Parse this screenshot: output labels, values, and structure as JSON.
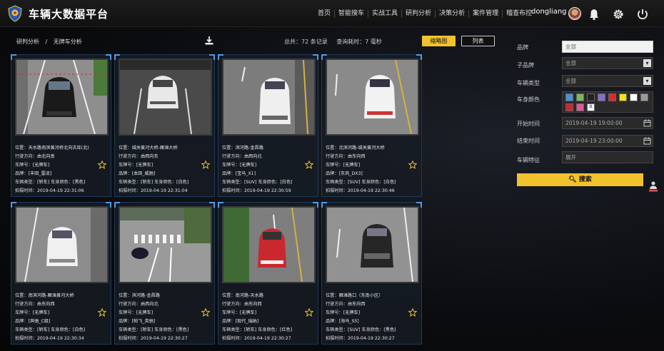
{
  "header": {
    "title": "车辆大数据平台",
    "nav": [
      "首页",
      "智能搜车",
      "实战工具",
      "研判分析",
      "决策分析",
      "案件管理",
      "稽查布控"
    ],
    "username": "dongliang",
    "icons": [
      "shield-logo-icon",
      "bell-icon",
      "gear-icon",
      "power-icon"
    ]
  },
  "breadcrumb": [
    "研判分析",
    "/",
    "无牌车分析"
  ],
  "summary": {
    "total": "总共：72 条记录",
    "time": "查询耗时：7 毫秒"
  },
  "view_buttons": {
    "thumb": "缩略图",
    "list": "列表"
  },
  "cards": [
    {
      "loc": "位置：",
      "loc_v": "天水路南滨黄河桥北向古库(北)",
      "dir": "行驶方向：",
      "dir_v": "由北向南",
      "plate": "车牌号：",
      "plate_v": "[无牌车]",
      "brand": "品牌：",
      "brand_v": "[丰田_雷凌]",
      "type": "车辆类型：",
      "type_v": "[轿车]",
      "color": "车身颜色：",
      "color_v": "[黑色]",
      "time": "拍摄时间：",
      "time_v": "2019-04-19 22:31:06"
    },
    {
      "loc": "位置：",
      "loc_v": "城关黄河大桥-雁滩大桥",
      "dir": "行驶方向：",
      "dir_v": "由西向东",
      "plate": "车牌号：",
      "plate_v": "[无牌车]",
      "brand": "品牌：",
      "brand_v": "[本田_威驰]",
      "type": "车辆类型：",
      "type_v": "[轿车]",
      "color": "车身颜色：",
      "color_v": "[白色]",
      "time": "拍摄时间：",
      "time_v": "2019-04-19 22:31:04"
    },
    {
      "loc": "位置：",
      "loc_v": "滨河路-金昌路",
      "dir": "行驶方向：",
      "dir_v": "由西向北",
      "plate": "车牌号：",
      "plate_v": "[无牌车]",
      "brand": "品牌：",
      "brand_v": "[宝马_X1]",
      "type": "车辆类型：",
      "type_v": "[SUV]",
      "color": "车身颜色：",
      "color_v": "[白色]",
      "time": "拍摄时间：",
      "time_v": "2019-04-19 22:30:59"
    },
    {
      "loc": "位置：",
      "loc_v": "北滨河路-城关黄河大桥",
      "dir": "行驶方向：",
      "dir_v": "由东向西",
      "plate": "车牌号：",
      "plate_v": "[无牌车]",
      "brand": "品牌：",
      "brand_v": "[东风_DX3]",
      "type": "车辆类型：",
      "type_v": "[SUV]",
      "color": "车身颜色：",
      "color_v": "[白色]",
      "time": "拍摄时间：",
      "time_v": "2019-04-19 22:30:46"
    },
    {
      "loc": "位置：",
      "loc_v": "南滨河路-雁滩黄河大桥",
      "dir": "行驶方向：",
      "dir_v": "由东向西",
      "plate": "车牌号：",
      "plate_v": "[无牌车]",
      "brand": "品牌：",
      "brand_v": "[奔驰_C级]",
      "type": "车辆类型：",
      "type_v": "[轿车]",
      "color": "车身颜色：",
      "color_v": "[白色]",
      "time": "拍摄时间：",
      "time_v": "2019-04-19 22:30:34"
    },
    {
      "loc": "位置：",
      "loc_v": "滨河路-金昌路",
      "dir": "行驶方向：",
      "dir_v": "由西向北",
      "plate": "车牌号：",
      "plate_v": "[无牌车]",
      "brand": "品牌：",
      "brand_v": "[帕飞_英驰]",
      "type": "车辆类型：",
      "type_v": "[轿车]",
      "color": "车身颜色：",
      "color_v": "[黑色]",
      "time": "拍摄时间：",
      "time_v": "2019-04-19 22:30:27"
    },
    {
      "loc": "位置：",
      "loc_v": "南河路-天水路",
      "dir": "行驶方向：",
      "dir_v": "由东向西",
      "plate": "车牌号：",
      "plate_v": "[无牌车]",
      "brand": "品牌：",
      "brand_v": "[现代_瑞纳]",
      "type": "车辆类型：",
      "type_v": "[轿车]",
      "color": "车身颜色：",
      "color_v": "[红色]",
      "time": "拍摄时间：",
      "time_v": "2019-04-19 22:30:27"
    },
    {
      "loc": "位置：",
      "loc_v": "雁滩路口（东南小区）",
      "dir": "行驶方向：",
      "dir_v": "由东向西",
      "plate": "车牌号：",
      "plate_v": "[无牌车]",
      "brand": "品牌：",
      "brand_v": "[海马_S5]",
      "type": "车辆类型：",
      "type_v": "[SUV]",
      "color": "车身颜色：",
      "color_v": "[黑色]",
      "time": "拍摄时间：",
      "time_v": "2019-04-19 22:30:27"
    }
  ],
  "filters": {
    "brand_label": "品牌",
    "brand_value": "全部",
    "subbrand_label": "子品牌",
    "subbrand_value": "全部",
    "vtype_label": "车辆类型",
    "vtype_value": "全部",
    "color_label": "车身颜色",
    "swatches": [
      "#4a90d9",
      "#7ab85a",
      "#222222",
      "#8a6dc9",
      "#e02828",
      "#f2e21e",
      "#ffffff",
      "#9a9a9a",
      "#c8282e",
      "#e05a9a",
      "#ffffff"
    ],
    "swatch_text": "其他",
    "start_label": "开始时间",
    "start_value": "2019-04-19 19:00:00",
    "end_label": "结束时间",
    "end_value": "2019-04-19 23:00:00",
    "feature_label": "车辆特征",
    "feature_value": "展开",
    "search_label": "搜索"
  }
}
